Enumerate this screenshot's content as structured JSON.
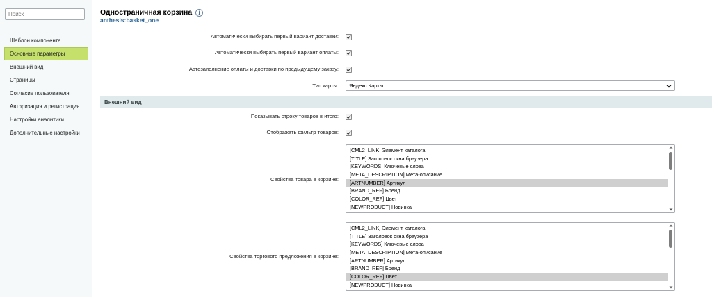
{
  "sidebar": {
    "search": {
      "placeholder": "Поиск",
      "value": ""
    },
    "items": [
      {
        "label": "Шаблон компонента",
        "active": false
      },
      {
        "label": "Основные параметры",
        "active": true
      },
      {
        "label": "Внешний вид",
        "active": false
      },
      {
        "label": "Страницы",
        "active": false
      },
      {
        "label": "Согласие пользователя",
        "active": false
      },
      {
        "label": "Авторизация и регистрация",
        "active": false
      },
      {
        "label": "Настройки аналитики",
        "active": false
      },
      {
        "label": "Дополнительные настройки",
        "active": false
      }
    ]
  },
  "header": {
    "title": "Одностраничная корзина",
    "info_icon": "i",
    "subtitle": "anthesis:basket_one"
  },
  "settings": {
    "auto_delivery": {
      "label": "Автоматически выбирать первый вариант доставки:",
      "checked": true
    },
    "auto_payment": {
      "label": "Автоматически выбирать первый вариант оплаты:",
      "checked": true
    },
    "autofill": {
      "label": "Автозаполнение оплаты и доставки по предыдущему заказу:",
      "checked": true
    },
    "map_type": {
      "label": "Тип карты:",
      "value": "Яндекс.Карты"
    }
  },
  "appearance": {
    "section_title": "Внешний вид",
    "show_total_row": {
      "label": "Показывать строку товаров в итого:",
      "checked": true
    },
    "show_filter": {
      "label": "Отображать фильтр товаров:",
      "checked": true
    },
    "product_props": {
      "label": "Свойства товара в корзине:",
      "options": [
        "[CML2_LINK] Элемент каталога",
        "[TITLE] Заголовок окна браузера",
        "[KEYWORDS] Ключевые слова",
        "[META_DESCRIPTION] Мета-описание",
        "[ARTNUMBER] Артикул",
        "[BRAND_REF] Бренд",
        "[COLOR_REF] Цвет",
        "[NEWPRODUCT] Новинка"
      ],
      "selected": [
        "[ARTNUMBER] Артикул"
      ]
    },
    "offer_props": {
      "label": "Свойства торгового предложения в корзине:",
      "options": [
        "[CML2_LINK] Элемент каталога",
        "[TITLE] Заголовок окна браузера",
        "[KEYWORDS] Ключевые слова",
        "[META_DESCRIPTION] Мета-описание",
        "[ARTNUMBER] Артикул",
        "[BRAND_REF] Бренд",
        "[COLOR_REF] Цвет",
        "[NEWPRODUCT] Новинка"
      ],
      "selected": [
        "[COLOR_REF] Цвет"
      ]
    }
  },
  "colors": {
    "active_nav": "#c5e06b",
    "section_header_bg": "#e0e9ec",
    "subtitle": "#2a6496",
    "list_selection": "#cfcfcf"
  }
}
